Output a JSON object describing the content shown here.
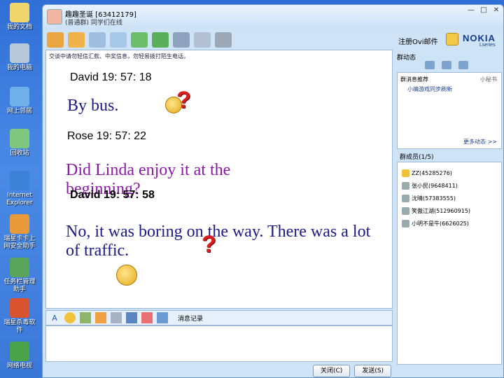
{
  "desktop": {
    "icons": [
      {
        "label": "我的文档",
        "icon": "folder-icon"
      },
      {
        "label": "我的电脑",
        "icon": "computer-icon"
      },
      {
        "label": "网上邻居",
        "icon": "network-icon"
      },
      {
        "label": "回收站",
        "icon": "recycle-bin-icon"
      },
      {
        "label": "Internet Explorer",
        "icon": "ie-icon"
      },
      {
        "label": "瑞星卡卡上网安全助手",
        "icon": "rising-icon"
      },
      {
        "label": "任务栏管理助手",
        "icon": "taskbar-helper-icon"
      },
      {
        "label": "瑞星杀毒软件",
        "icon": "antivirus-icon"
      },
      {
        "label": "网络电视",
        "icon": "tv-icon"
      }
    ]
  },
  "window": {
    "title_name": "趣趣圣诞 [63412179]",
    "title_sub": "(普通群) 同学们在线",
    "controls": [
      "—",
      "□",
      "✕"
    ]
  },
  "nokia": {
    "register": "注册Ovi邮件",
    "logo": "NOKIA",
    "sub": "Lseries"
  },
  "chat": {
    "notice": "交谈中请勿轻信汇款、中奖信息，勿轻易拨打陌生电话。",
    "messages": [
      {
        "sender": "David 19: 57: 18",
        "text": "By bus."
      },
      {
        "sender": "Rose 19: 57: 22",
        "text": "Did Linda enjoy it at the beginning?"
      },
      {
        "sender": "David 19: 57: 58",
        "text": "No, it was boring on the way. There was a lot of traffic."
      }
    ]
  },
  "input_toolbar": {
    "chat_log": "消息记录"
  },
  "buttons": {
    "close": "关闭(C)",
    "send": "发送(S)"
  },
  "right_panel": {
    "title": "群动态",
    "row1": "群消息推荐",
    "row1b": "小秘书",
    "row2": "小编游戏同步刷新",
    "row3": "更多动态 >>",
    "members_title": "群成员(1/5)",
    "members": [
      "ZZ(45285276)",
      "张小民(9648411)",
      "沈晴(57383555)",
      "笑傲江湖(512960915)",
      "小明不是牛(6626025)"
    ]
  }
}
